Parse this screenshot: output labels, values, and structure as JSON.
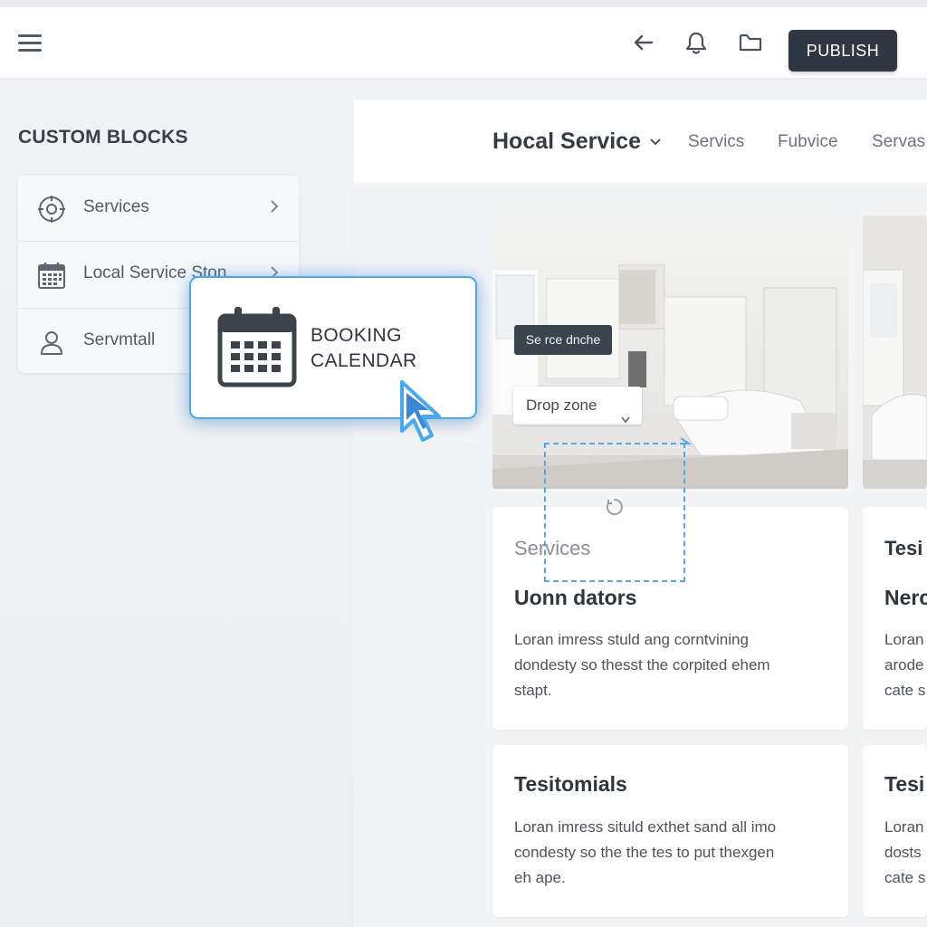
{
  "toolbar": {
    "publish_label": "PUBLISH",
    "icons": [
      "menu-icon",
      "back-arrow-icon",
      "notification-icon",
      "folder-icon"
    ]
  },
  "sidebar": {
    "title": "CUSTOM BLOCKS",
    "items": [
      {
        "label": "Services",
        "icon": "target-icon"
      },
      {
        "label": "Local Service Ston",
        "icon": "calendar-icon"
      },
      {
        "label": "Servmtall",
        "icon": "user-icon"
      }
    ]
  },
  "drag_block": {
    "label_line1": "BOOKING",
    "label_line2": "CALENDAR",
    "icon": "calendar-icon"
  },
  "page_nav": {
    "title": "Hocal Service",
    "links": [
      "Servics",
      "Fubvice",
      "Servas"
    ]
  },
  "overlay": {
    "tooltip": "Se rce dnche",
    "drop_select": "Drop zone"
  },
  "cards": {
    "services": {
      "kicker": "Services",
      "title": "Uonn dators",
      "body": [
        "Loran imress stuld ang corntvining",
        "dondesty so thesst the corpited ehem",
        "stapt."
      ]
    },
    "testimonials": {
      "title": "Tesitomials",
      "body": [
        "Loran imress situld exthet sand all imo",
        "condesty so the the tes to put thexgen",
        "eh ape."
      ]
    },
    "right_top": {
      "kicker": "Tesi",
      "title": "Nerc",
      "body": [
        "Loran",
        "arode",
        "cate s"
      ]
    },
    "right_bottom": {
      "title": "Tesi",
      "body": [
        "Loran",
        "dosts",
        "cate s"
      ]
    }
  },
  "colors": {
    "accent": "#4aa8ef",
    "publish_bg": "#2f3742"
  }
}
